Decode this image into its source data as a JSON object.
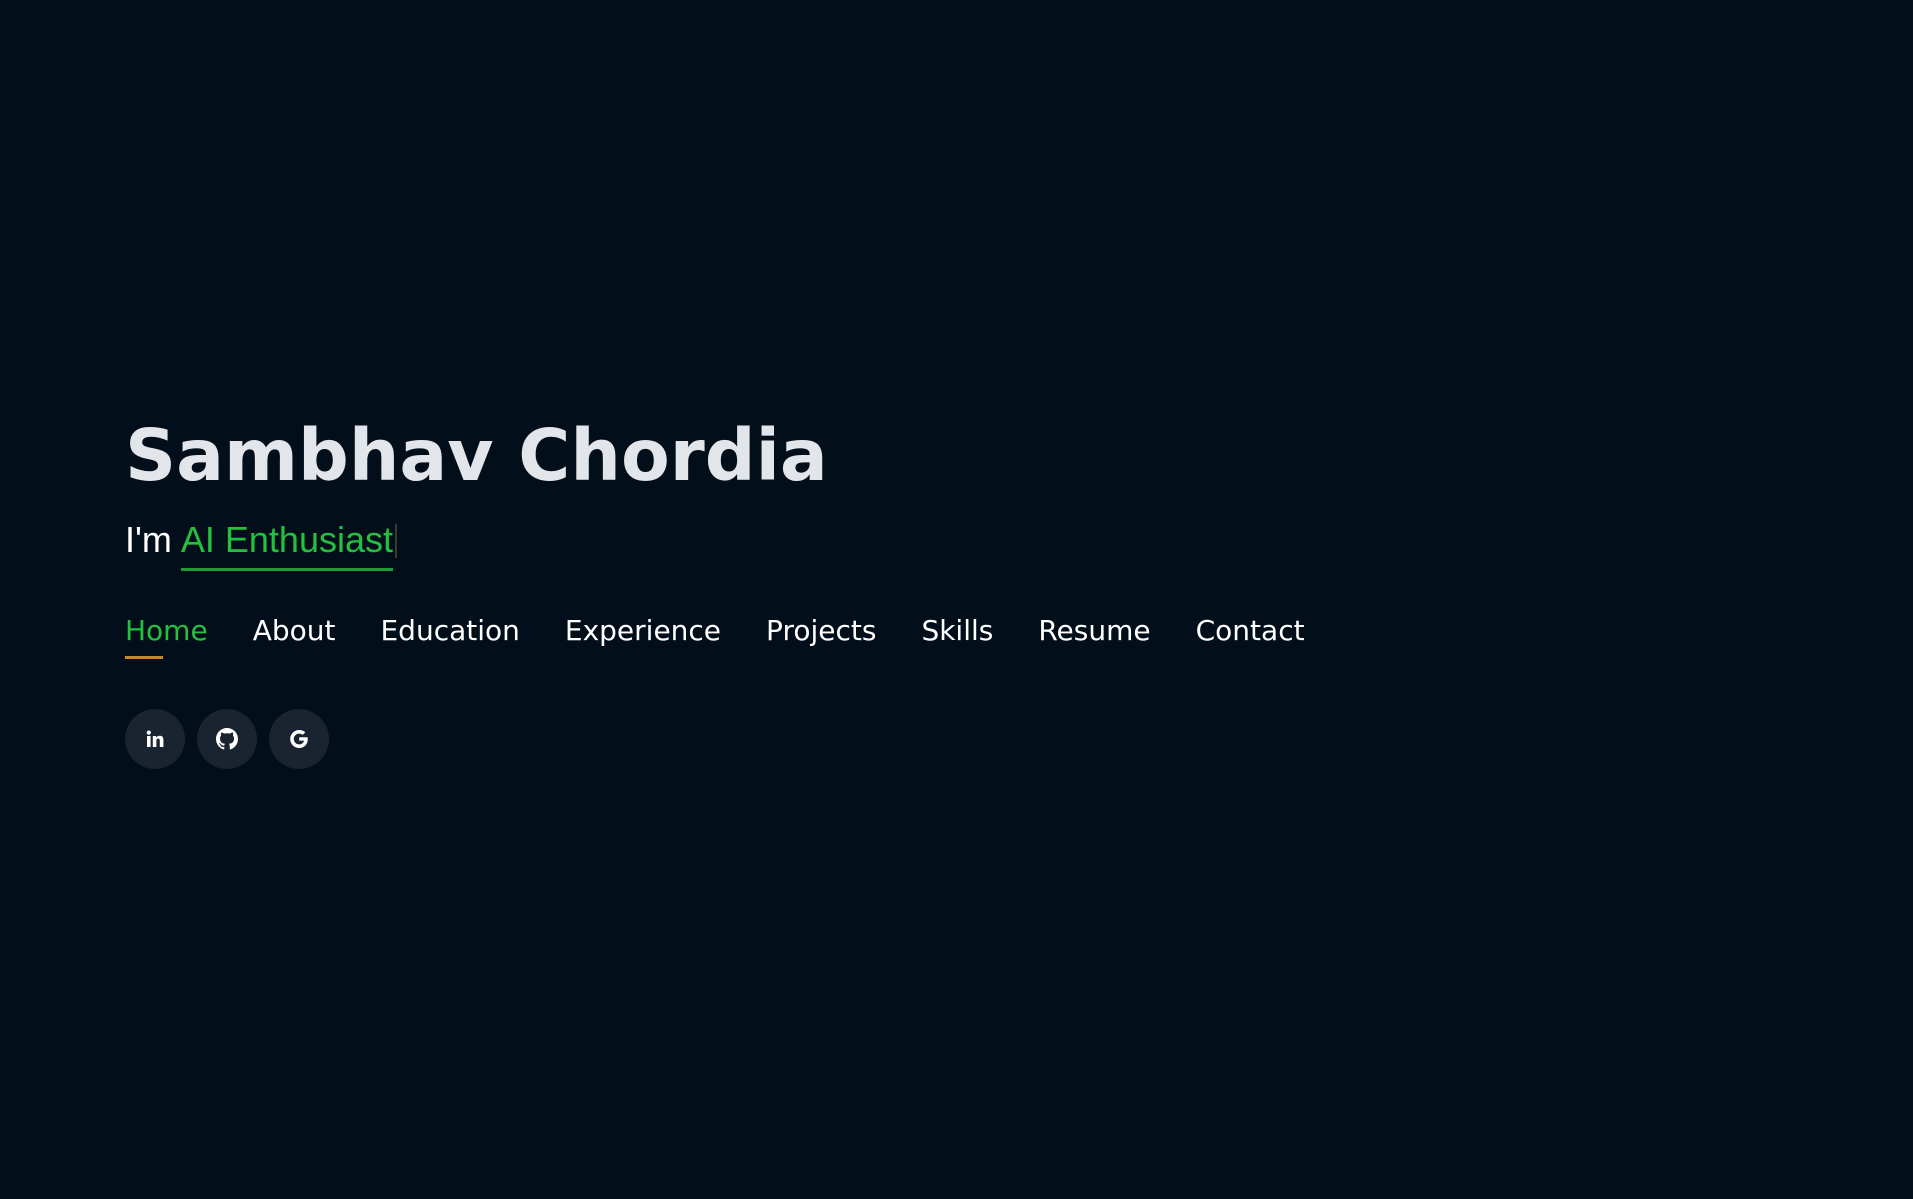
{
  "hero": {
    "name": "Sambhav Chordia",
    "tagline_prefix": "I'm",
    "tagline_typed": "AI Enthusiast"
  },
  "nav": {
    "items": [
      {
        "label": "Home",
        "active": true
      },
      {
        "label": "About"
      },
      {
        "label": "Education"
      },
      {
        "label": "Experience"
      },
      {
        "label": "Projects"
      },
      {
        "label": "Skills"
      },
      {
        "label": "Resume"
      },
      {
        "label": "Contact"
      }
    ]
  },
  "socials": {
    "icons": [
      "linkedin-icon",
      "github-icon",
      "google-icon"
    ]
  },
  "colors": {
    "background": "#020e1a",
    "accent_green": "#26c03f",
    "active_underline": "#c9872c",
    "social_bg": "#1a2330"
  }
}
